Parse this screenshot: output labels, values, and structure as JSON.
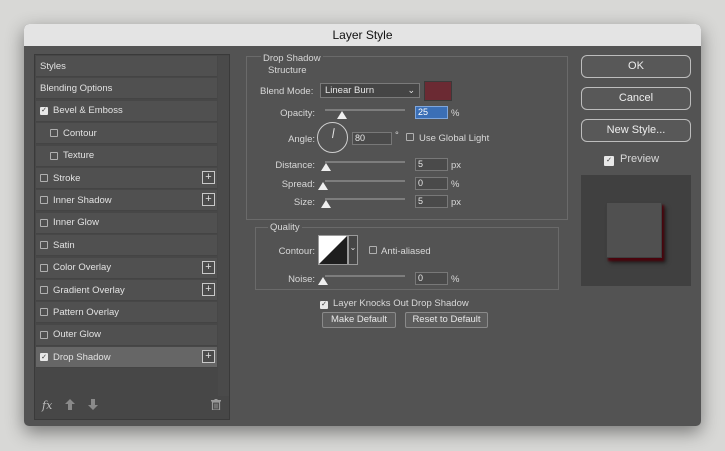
{
  "dialog": {
    "title": "Layer Style"
  },
  "styles_list": [
    {
      "label": "Styles",
      "checkbox": false,
      "checked": false,
      "plus": false,
      "sub": false,
      "selected": false
    },
    {
      "label": "Blending Options",
      "checkbox": false,
      "checked": false,
      "plus": false,
      "sub": false,
      "selected": false
    },
    {
      "label": "Bevel & Emboss",
      "checkbox": true,
      "checked": true,
      "plus": false,
      "sub": false,
      "selected": false
    },
    {
      "label": "Contour",
      "checkbox": true,
      "checked": false,
      "plus": false,
      "sub": true,
      "selected": false
    },
    {
      "label": "Texture",
      "checkbox": true,
      "checked": false,
      "plus": false,
      "sub": true,
      "selected": false
    },
    {
      "label": "Stroke",
      "checkbox": true,
      "checked": false,
      "plus": true,
      "sub": false,
      "selected": false
    },
    {
      "label": "Inner Shadow",
      "checkbox": true,
      "checked": false,
      "plus": true,
      "sub": false,
      "selected": false
    },
    {
      "label": "Inner Glow",
      "checkbox": true,
      "checked": false,
      "plus": false,
      "sub": false,
      "selected": false
    },
    {
      "label": "Satin",
      "checkbox": true,
      "checked": false,
      "plus": false,
      "sub": false,
      "selected": false
    },
    {
      "label": "Color Overlay",
      "checkbox": true,
      "checked": false,
      "plus": true,
      "sub": false,
      "selected": false
    },
    {
      "label": "Gradient Overlay",
      "checkbox": true,
      "checked": false,
      "plus": true,
      "sub": false,
      "selected": false
    },
    {
      "label": "Pattern Overlay",
      "checkbox": true,
      "checked": false,
      "plus": false,
      "sub": false,
      "selected": false
    },
    {
      "label": "Outer Glow",
      "checkbox": true,
      "checked": false,
      "plus": false,
      "sub": false,
      "selected": false
    },
    {
      "label": "Drop Shadow",
      "checkbox": true,
      "checked": true,
      "plus": true,
      "sub": false,
      "selected": true
    }
  ],
  "left_footer": {
    "fx_label": "fx"
  },
  "drop_shadow": {
    "section_title": "Drop Shadow",
    "structure_title": "Structure",
    "blend_mode_label": "Blend Mode:",
    "blend_mode_value": "Linear Burn",
    "shadow_color": "#6b2a33",
    "opacity_label": "Opacity:",
    "opacity_value": "25",
    "opacity_unit": "%",
    "angle_label": "Angle:",
    "angle_value": "80",
    "angle_unit": "°",
    "use_global_light_label": "Use Global Light",
    "use_global_light_checked": false,
    "distance_label": "Distance:",
    "distance_value": "5",
    "distance_unit": "px",
    "spread_label": "Spread:",
    "spread_value": "0",
    "spread_unit": "%",
    "size_label": "Size:",
    "size_value": "5",
    "size_unit": "px",
    "quality_title": "Quality",
    "contour_label": "Contour:",
    "anti_aliased_label": "Anti-aliased",
    "anti_aliased_checked": false,
    "noise_label": "Noise:",
    "noise_value": "0",
    "noise_unit": "%",
    "layer_knocks_out_label": "Layer Knocks Out Drop Shadow",
    "layer_knocks_out_checked": true,
    "make_default_label": "Make Default",
    "reset_default_label": "Reset to Default"
  },
  "right_buttons": {
    "ok_label": "OK",
    "cancel_label": "Cancel",
    "new_style_label": "New Style...",
    "preview_label": "Preview",
    "preview_checked": true
  }
}
